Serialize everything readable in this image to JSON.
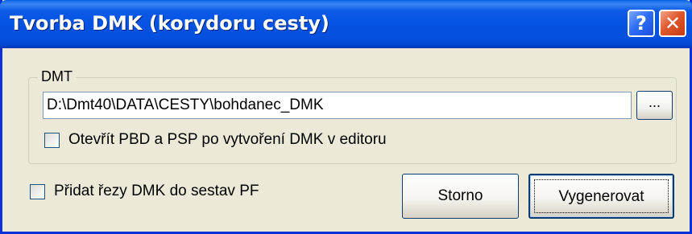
{
  "window": {
    "title": "Tvorba DMK (korydoru cesty)",
    "help_label": "?",
    "close_label": "✕"
  },
  "dmt_group": {
    "label": "DMT",
    "path_value": "D:\\Dmt40\\DATA\\CESTY\\bohdanec_DMK",
    "browse_label": "...",
    "open_checkbox_label": "Otevřít PBD a PSP po vytvoření DMK v editoru",
    "open_checkbox_checked": false
  },
  "options": {
    "add_sections_label": "Přidat řezy DMK do sestav PF",
    "add_sections_checked": false
  },
  "buttons": {
    "cancel_label": "Storno",
    "generate_label": "Vygenerovat"
  },
  "icons": {
    "help": "help-icon",
    "close": "close-icon"
  },
  "colors": {
    "titlebar": "#0553e2",
    "window_bg": "#ece9d8",
    "close_button": "#e0582e"
  }
}
